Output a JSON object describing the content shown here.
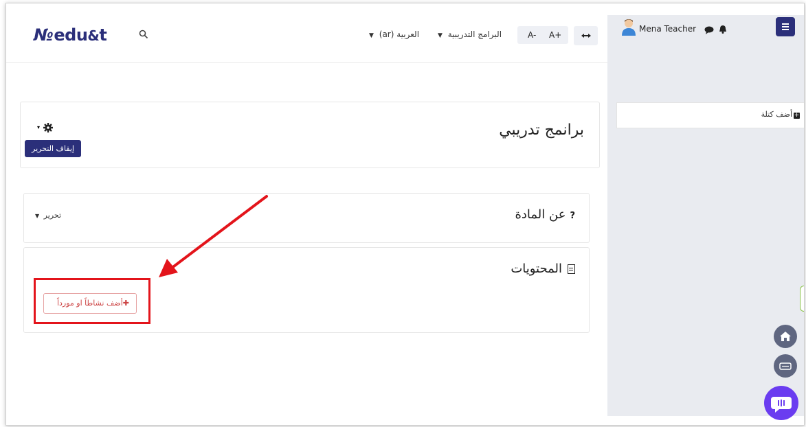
{
  "header": {
    "logo": "edu",
    "logo_suffix": "t",
    "language": "العربية (ar)",
    "programs_menu": "البرامج التدريبية",
    "font_decrease": "A-",
    "font_increase": "A+",
    "dash": "⟷"
  },
  "sidebar": {
    "username": "Mena Teacher",
    "add_block": "أضف كتلة"
  },
  "page": {
    "title": "برانمج تدريبي",
    "stop_editing": "إيقاف التحرير"
  },
  "sections": {
    "about": {
      "title": "عن المادة",
      "edit": "تحرير"
    },
    "contents": {
      "title": "المحتويات",
      "add_activity": "أضف نشاطاً او مورداً"
    }
  },
  "colors": {
    "brand": "#2b2f7a",
    "highlight": "#e3141b",
    "chat_button": "#6a3cf0"
  }
}
